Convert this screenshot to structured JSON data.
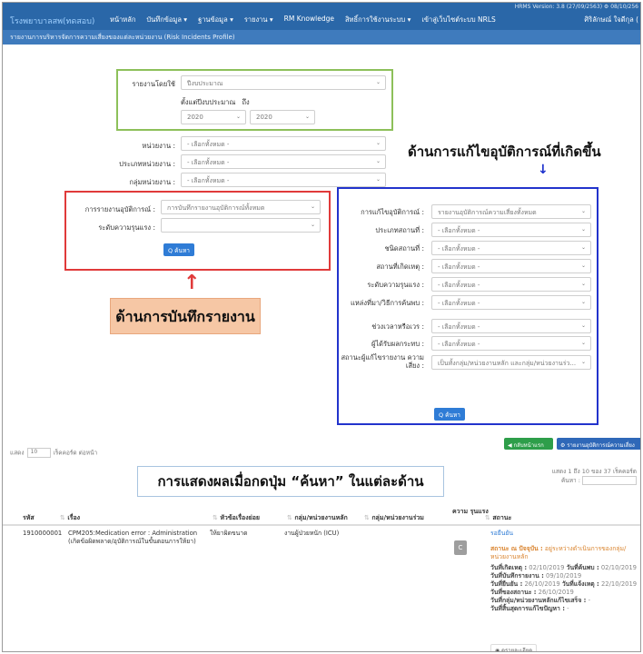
{
  "header": {
    "version": "HRMS Version: 3.8 (27/09/2563) ⚙ 08/10/256",
    "brand": "โรงพยาบาลสพ(ทดสอบ)",
    "nav": [
      "หน้าหลัก",
      "บันทึกข้อมูล ▾",
      "ฐานข้อมูล ▾",
      "รายงาน ▾",
      "RM Knowledge",
      "สิทธิ์การใช้งานระบบ ▾",
      "เข้าสู่เว็บไซต์ระบบ NRLS"
    ],
    "user": "ศิริลักษณ์ ใจดีกุล ("
  },
  "subheader": "รายงานการบริหารจัดการความเสี่ยงของแต่ละหน่วยงาน (Risk Incidents Profile)",
  "filters": {
    "report_by_label": "รายงานโดยใช้",
    "report_by_value": "ปีงบประมาณ",
    "fiscal_label": "ตั้งแต่ปีงบประมาณ",
    "to_label": "ถึง",
    "from_year": "2020",
    "to_year": "2020",
    "unit_label": "หน่วยงาน :",
    "unit_value": "- เลือกทั้งหมด -",
    "unit_type_label": "ประเภทหน่วยงาน :",
    "unit_type_value": "- เลือกทั้งหมด -",
    "unit_group_label": "กลุ่มหน่วยงาน :",
    "unit_group_value": "- เลือกทั้งหมด -"
  },
  "report_panel": {
    "incident_report_label": "การรายงานอุบัติการณ์ :",
    "incident_report_value": "การบันทึกรายงานอุบัติการณ์ทั้งหมด",
    "severity_label": "ระดับความรุนแรง :",
    "severity_value": "",
    "search_label": "Q ค้นหา"
  },
  "fix_panel": {
    "fields": [
      {
        "label": "การแก้ไขอุบัติการณ์ :",
        "value": "รายงานอุบัติการณ์ความเสี่ยงทั้งหมด"
      },
      {
        "label": "ประเภทสถานที่ :",
        "value": "- เลือกทั้งหมด -"
      },
      {
        "label": "ชนิดสถานที่ :",
        "value": "- เลือกทั้งหมด -"
      },
      {
        "label": "สถานที่เกิดเหตุ :",
        "value": "- เลือกทั้งหมด -"
      },
      {
        "label": "ระดับความรุนแรง :",
        "value": "- เลือกทั้งหมด -"
      },
      {
        "label": "แหล่งที่มา/วิธีการค้นพบ :",
        "value": "- เลือกทั้งหมด -"
      },
      {
        "label": "ช่วงเวลาหรือเวร :",
        "value": "- เลือกทั้งหมด -"
      },
      {
        "label": "ผู้ได้รับผลกระทบ :",
        "value": "- เลือกทั้งหมด -"
      },
      {
        "label": "สถานะผู้แก้ไขรายงาน ความเสี่ยง :",
        "value": "เป็นทั้งกลุ่ม/หน่วยงานหลัก และกลุ่ม/หน่วยงานร่ว..."
      }
    ],
    "search_label": "Q ค้นหา"
  },
  "annotations": {
    "fix_title": "ด้านการแก้ไขอุบัติการณ์ที่เกิดขึ้น",
    "report_title": "ด้านการบันทึกรายงาน",
    "results_title": "การแสดงผลเมื่อกดปุ่ม “ค้นหา” ในแต่ละด้าน"
  },
  "actions": {
    "back_label": "◀ กลับหน้าแรก",
    "report_label": "⚙ รายงานอุบัติการณ์ความเสี่ยง"
  },
  "list_controls": {
    "show_label": "แสดง",
    "page_size": "10",
    "records_label": "เร็คคอร์ด ต่อหน้า",
    "paging_info": "แสดง 1 ถึง 10 ของ 37 เร็คคอร์ด",
    "search_label": "ค้นหา :"
  },
  "table": {
    "headers": {
      "id": "รหัส",
      "title": "เรื่อง",
      "topic": "หัวข้อเรื่องย่อย",
      "main_unit": "กลุ่ม/หน่วยงานหลัก",
      "co_unit": "กลุ่ม/หน่วยงานร่วม",
      "severity": "ความ รุนแรง",
      "status": "สถานะ"
    },
    "rows": [
      {
        "id": "1910000001",
        "title": "CPM205:Medication error : Administration (เกิดข้อผิดพลาด/อุบัติการณ์ในขั้นตอนการให้ยา)",
        "topic": "ให้ยาผิดขนาด",
        "main_unit": "งานผู้ป่วยหนัก (ICU)",
        "co_unit": "",
        "severity": "C",
        "status_link": "รอยืนยัน",
        "status_note_key": "สถานะ ณ ปัจจุบัน :",
        "status_note_val": "อยู่ระหว่างดำเนินการของกลุ่ม/หน่วยงานหลัก",
        "lines": [
          {
            "k": "วันที่เกิดเหตุ :",
            "v": "02/10/2019",
            "k2": "วันที่ค้นพบ :",
            "v2": "02/10/2019"
          },
          {
            "k": "วันที่บันทึกรายงาน :",
            "v": "09/10/2019",
            "k2": "",
            "v2": ""
          },
          {
            "k": "วันที่ยืนยัน :",
            "v": "26/10/2019",
            "k2": "วันที่แจ้งเหตุ :",
            "v2": "22/10/2019"
          },
          {
            "k": "วันที่ของสถานะ :",
            "v": "26/10/2019",
            "k2": "",
            "v2": ""
          },
          {
            "k": "วันที่กลุ่ม/หน่วยงานหลักแก้ไขเสร็จ :",
            "v": "-",
            "k2": "",
            "v2": ""
          },
          {
            "k": "วันที่สิ้นสุดการแก้ไขปัญหา :",
            "v": "-",
            "k2": "",
            "v2": ""
          }
        ],
        "detail_label": "◉ ดูรายละเอียด"
      }
    ]
  },
  "colors": {
    "nav_bg": "#2a67a8",
    "green_box": "#8dc05a",
    "red_box": "#e03a3a",
    "blue_box": "#2233cc",
    "callout": "#f6c7a5"
  }
}
